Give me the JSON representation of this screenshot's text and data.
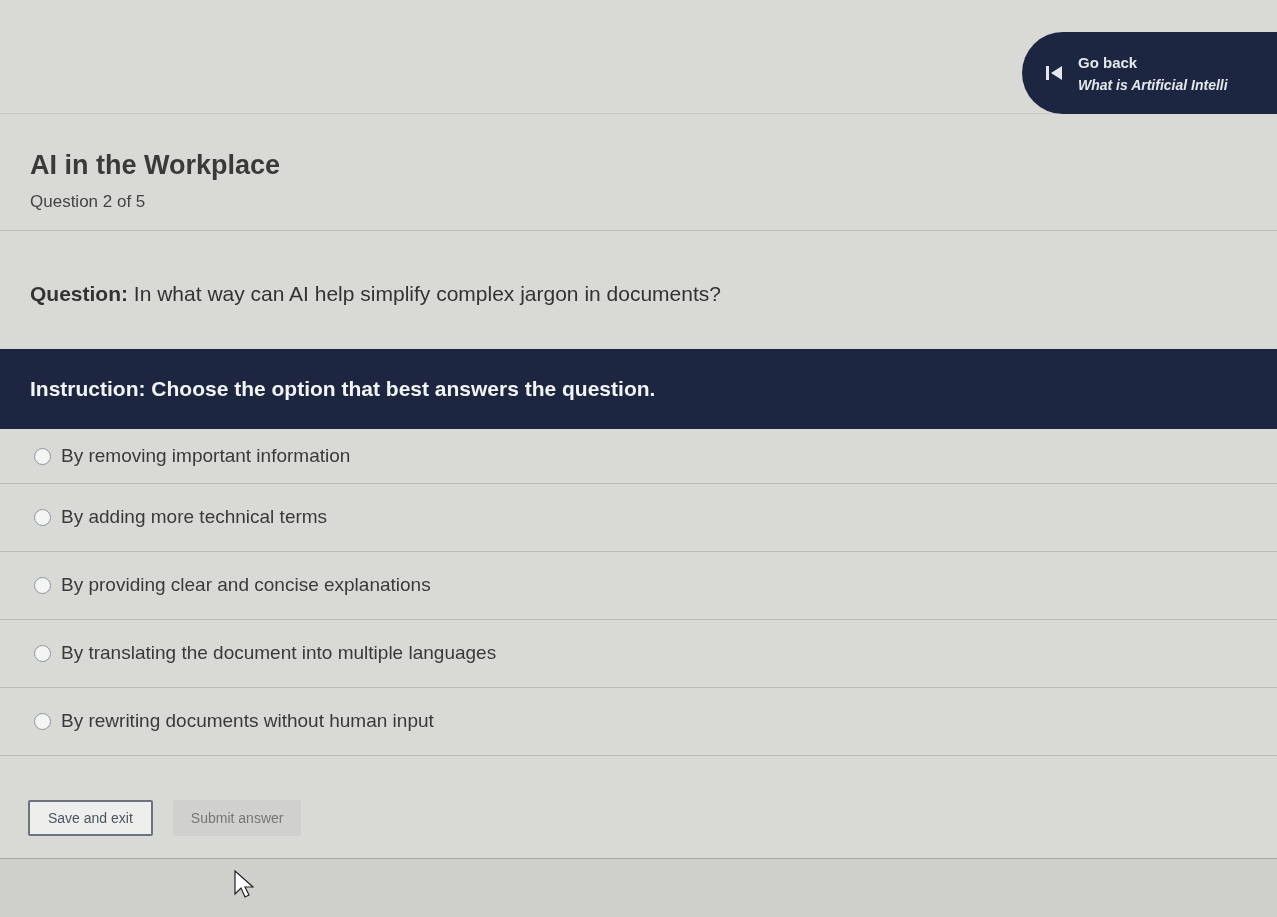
{
  "header": {
    "back_label": "Go back",
    "lesson_title": "What is Artificial Intelli"
  },
  "quiz": {
    "title": "AI in the Workplace",
    "progress": "Question 2 of 5"
  },
  "question": "**Question:** In what way can AI help simplify complex jargon in documents?",
  "instruction": "Instruction: Choose the option that best answers the question.",
  "options": [
    {
      "label": "By removing important information",
      "selected": false
    },
    {
      "label": "By adding more technical terms",
      "selected": false
    },
    {
      "label": "By providing clear and concise explanations",
      "selected": false
    },
    {
      "label": "By translating the document into multiple languages",
      "selected": false
    },
    {
      "label": "By rewriting documents without human input",
      "selected": false
    }
  ],
  "buttons": [
    {
      "kind": "outline",
      "label": "Save and exit",
      "disabled": false
    },
    {
      "kind": "primary",
      "label": "Submit answer",
      "disabled": true
    }
  ]
}
